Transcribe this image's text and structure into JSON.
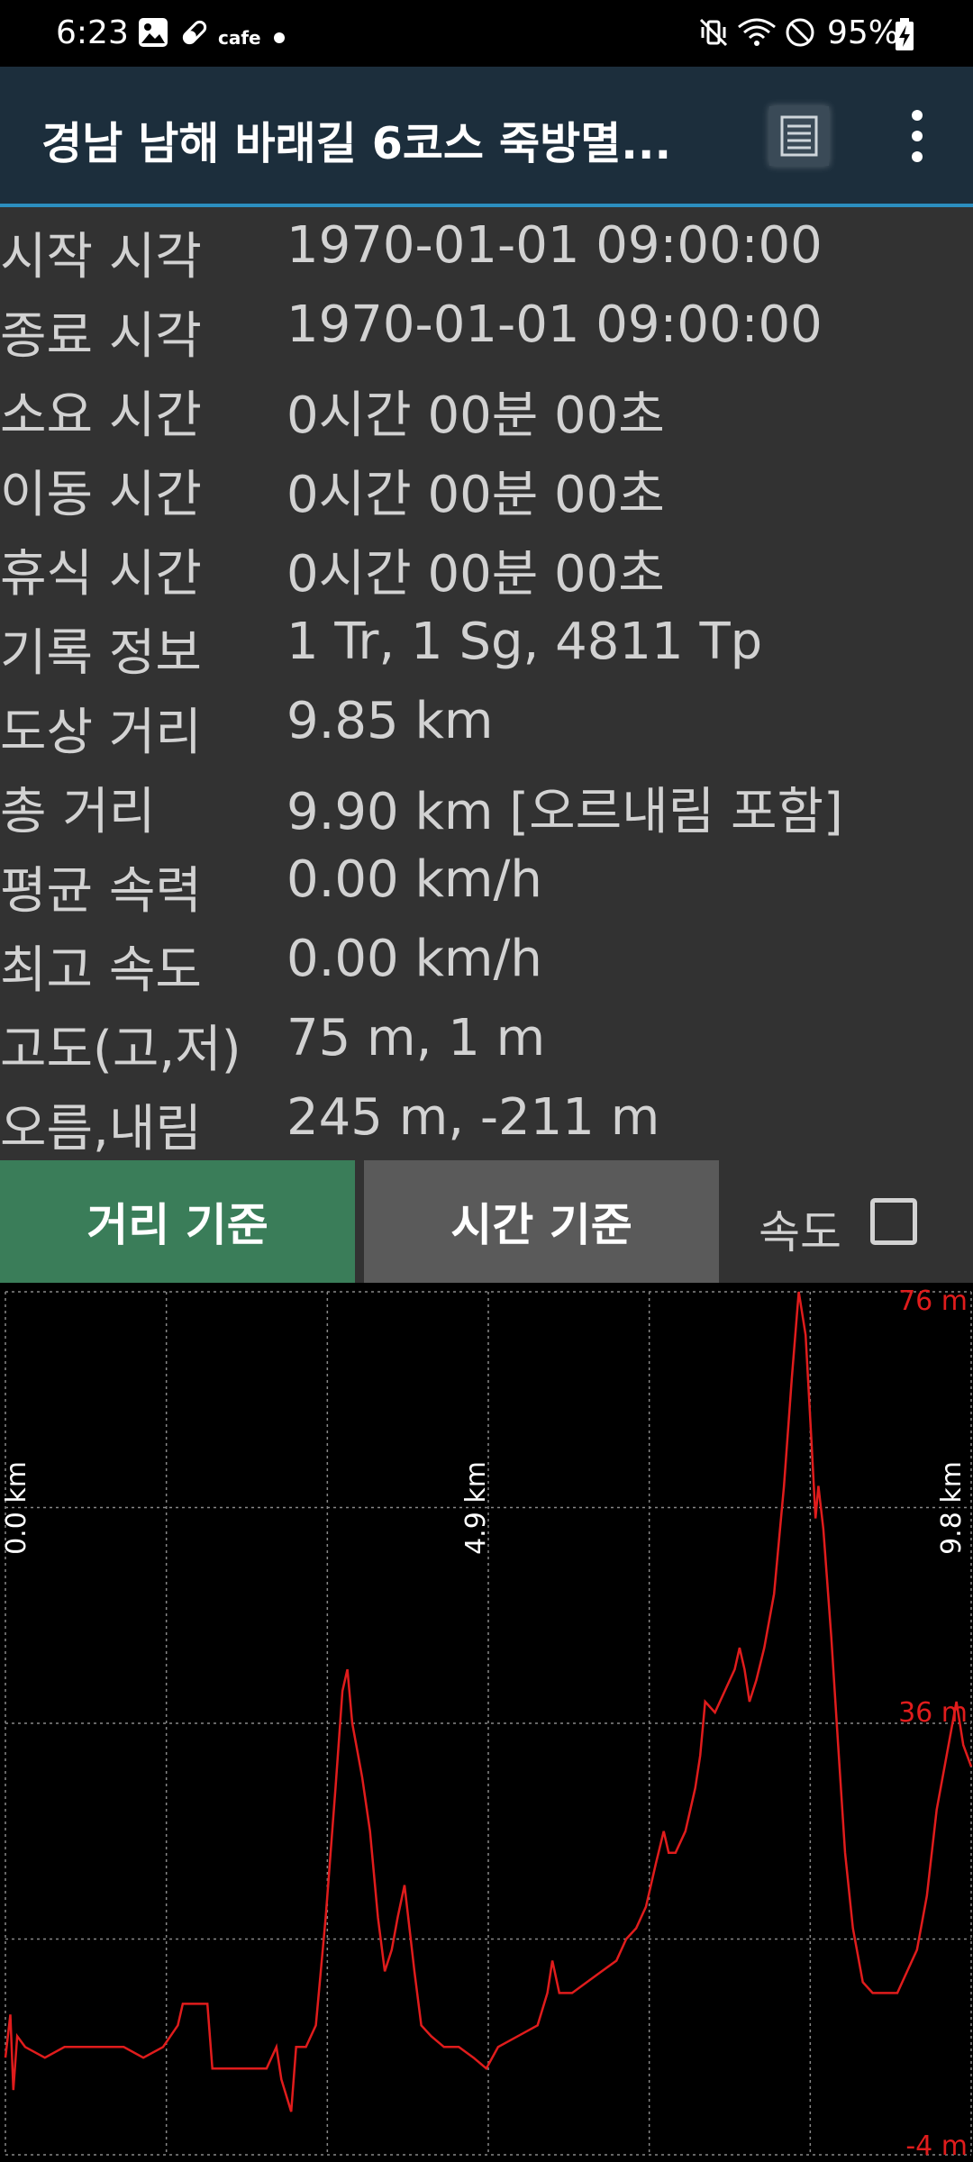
{
  "status_bar": {
    "time": "6:23",
    "app_label": "cafe",
    "battery": "95%"
  },
  "app_bar": {
    "title": "경남 남해 바래길 6코스 죽방멸..."
  },
  "stats": [
    {
      "label": "시작 시각",
      "value": "1970-01-01 09:00:00"
    },
    {
      "label": "종료 시각",
      "value": "1970-01-01 09:00:00"
    },
    {
      "label": "소요 시간",
      "value": "0시간 00분 00초"
    },
    {
      "label": "이동 시간",
      "value": "0시간 00분 00초"
    },
    {
      "label": "휴식 시간",
      "value": "0시간 00분 00초"
    },
    {
      "label": "기록 정보",
      "value": "1 Tr, 1 Sg, 4811 Tp"
    },
    {
      "label": "도상 거리",
      "value": "9.85 km"
    },
    {
      "label": "총 거리",
      "value": "9.90 km [오르내림 포함]"
    },
    {
      "label": "평균 속력",
      "value": "0.00 km/h"
    },
    {
      "label": "최고 속도",
      "value": "0.00 km/h"
    },
    {
      "label": "고도(고,저)",
      "value": "75 m, 1 m"
    },
    {
      "label": "오름,내림",
      "value": "245 m, -211 m"
    }
  ],
  "mode_buttons": {
    "distance": "거리 기준",
    "time": "시간 기준",
    "speed_label": "속도",
    "speed_checked": false
  },
  "colors": {
    "accent_green": "#3a7d59",
    "line_red": "#e01c1c",
    "app_bar": "#1c2e3c"
  },
  "chart_data": {
    "type": "line",
    "x_tick_labels": [
      "0.0 km",
      "4.9 km",
      "9.8 km"
    ],
    "y_tick_labels": [
      "76 m",
      "36 m",
      "-4 m"
    ],
    "xlim": [
      0,
      9.8
    ],
    "ylim": [
      -4,
      76
    ],
    "grid": true,
    "series": [
      {
        "values_km_m": [
          [
            0.0,
            5
          ],
          [
            0.05,
            9
          ],
          [
            0.08,
            2
          ],
          [
            0.12,
            7
          ],
          [
            0.2,
            6
          ],
          [
            0.4,
            5
          ],
          [
            0.6,
            6
          ],
          [
            0.8,
            6
          ],
          [
            1.0,
            6
          ],
          [
            1.2,
            6
          ],
          [
            1.4,
            5
          ],
          [
            1.6,
            6
          ],
          [
            1.75,
            8
          ],
          [
            1.8,
            10
          ],
          [
            1.95,
            10
          ],
          [
            2.05,
            10
          ],
          [
            2.1,
            4
          ],
          [
            2.3,
            4
          ],
          [
            2.5,
            4
          ],
          [
            2.65,
            4
          ],
          [
            2.75,
            6
          ],
          [
            2.8,
            3
          ],
          [
            2.9,
            0
          ],
          [
            2.95,
            6
          ],
          [
            3.05,
            6
          ],
          [
            3.15,
            8
          ],
          [
            3.25,
            18
          ],
          [
            3.35,
            30
          ],
          [
            3.42,
            39
          ],
          [
            3.47,
            41
          ],
          [
            3.52,
            36
          ],
          [
            3.62,
            31
          ],
          [
            3.7,
            26
          ],
          [
            3.78,
            18
          ],
          [
            3.85,
            13
          ],
          [
            3.92,
            15
          ],
          [
            3.98,
            18
          ],
          [
            4.05,
            21
          ],
          [
            4.1,
            17
          ],
          [
            4.15,
            13
          ],
          [
            4.22,
            8
          ],
          [
            4.32,
            7
          ],
          [
            4.45,
            6
          ],
          [
            4.6,
            6
          ],
          [
            4.75,
            5
          ],
          [
            4.88,
            4
          ],
          [
            5.0,
            6
          ],
          [
            5.2,
            7
          ],
          [
            5.4,
            8
          ],
          [
            5.5,
            11
          ],
          [
            5.55,
            14
          ],
          [
            5.62,
            11
          ],
          [
            5.75,
            11
          ],
          [
            5.9,
            12
          ],
          [
            6.05,
            13
          ],
          [
            6.2,
            14
          ],
          [
            6.3,
            16
          ],
          [
            6.4,
            17
          ],
          [
            6.5,
            19
          ],
          [
            6.6,
            23
          ],
          [
            6.68,
            26
          ],
          [
            6.73,
            24
          ],
          [
            6.8,
            24
          ],
          [
            6.9,
            26
          ],
          [
            7.0,
            30
          ],
          [
            7.05,
            33
          ],
          [
            7.1,
            38
          ],
          [
            7.2,
            37
          ],
          [
            7.3,
            39
          ],
          [
            7.4,
            41
          ],
          [
            7.45,
            43
          ],
          [
            7.5,
            41
          ],
          [
            7.55,
            38
          ],
          [
            7.62,
            40
          ],
          [
            7.7,
            43
          ],
          [
            7.8,
            48
          ],
          [
            7.9,
            58
          ],
          [
            7.98,
            68
          ],
          [
            8.05,
            76
          ],
          [
            8.12,
            72
          ],
          [
            8.18,
            62
          ],
          [
            8.22,
            55
          ],
          [
            8.25,
            58
          ],
          [
            8.3,
            54
          ],
          [
            8.38,
            44
          ],
          [
            8.45,
            34
          ],
          [
            8.52,
            24
          ],
          [
            8.6,
            17
          ],
          [
            8.7,
            12
          ],
          [
            8.8,
            11
          ],
          [
            8.95,
            11
          ],
          [
            9.05,
            11
          ],
          [
            9.15,
            13
          ],
          [
            9.25,
            15
          ],
          [
            9.35,
            20
          ],
          [
            9.45,
            28
          ],
          [
            9.55,
            33
          ],
          [
            9.65,
            38
          ],
          [
            9.72,
            34
          ],
          [
            9.8,
            32
          ]
        ]
      }
    ]
  }
}
